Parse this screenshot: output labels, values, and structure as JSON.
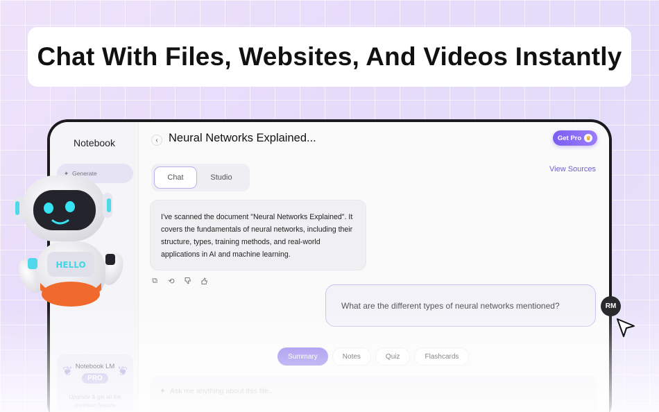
{
  "headline": "Chat With Files, Websites, And Videos Instantly",
  "sidebar": {
    "title": "Notebook",
    "generate_label": "Generate",
    "pro_card": {
      "title": "Notebook LM",
      "badge": "PRO",
      "description": "Upgrade & get all the premium feature"
    }
  },
  "header": {
    "back_icon": "chevron-left-icon",
    "title": "Neural Networks Explained...",
    "get_pro_label": "Get Pro"
  },
  "view_sources_label": "View Sources",
  "tabs": [
    {
      "label": "Chat",
      "active": true
    },
    {
      "label": "Studio",
      "active": false
    }
  ],
  "messages": {
    "bot": "I've scanned the document \"Neural Networks Explained\". It covers the fundamentals of neural networks, including their structure, types, training methods, and real-world applications in AI and machine learning.",
    "user": "What are the different types of neural networks mentioned?"
  },
  "message_actions": [
    "copy-icon",
    "regenerate-icon",
    "thumbs-down-icon",
    "thumbs-up-icon"
  ],
  "quick_actions": [
    {
      "label": "Summary",
      "active": true
    },
    {
      "label": "Notes",
      "active": false
    },
    {
      "label": "Quiz",
      "active": false
    },
    {
      "label": "Flashcards",
      "active": false
    }
  ],
  "composer": {
    "placeholder": "Ask me anything about this file..."
  },
  "user_avatar": "RM",
  "robot_screen_text": "HELLO",
  "colors": {
    "accent": "#8d78ec",
    "link": "#6d63c8",
    "device": "#1a1a1f"
  }
}
